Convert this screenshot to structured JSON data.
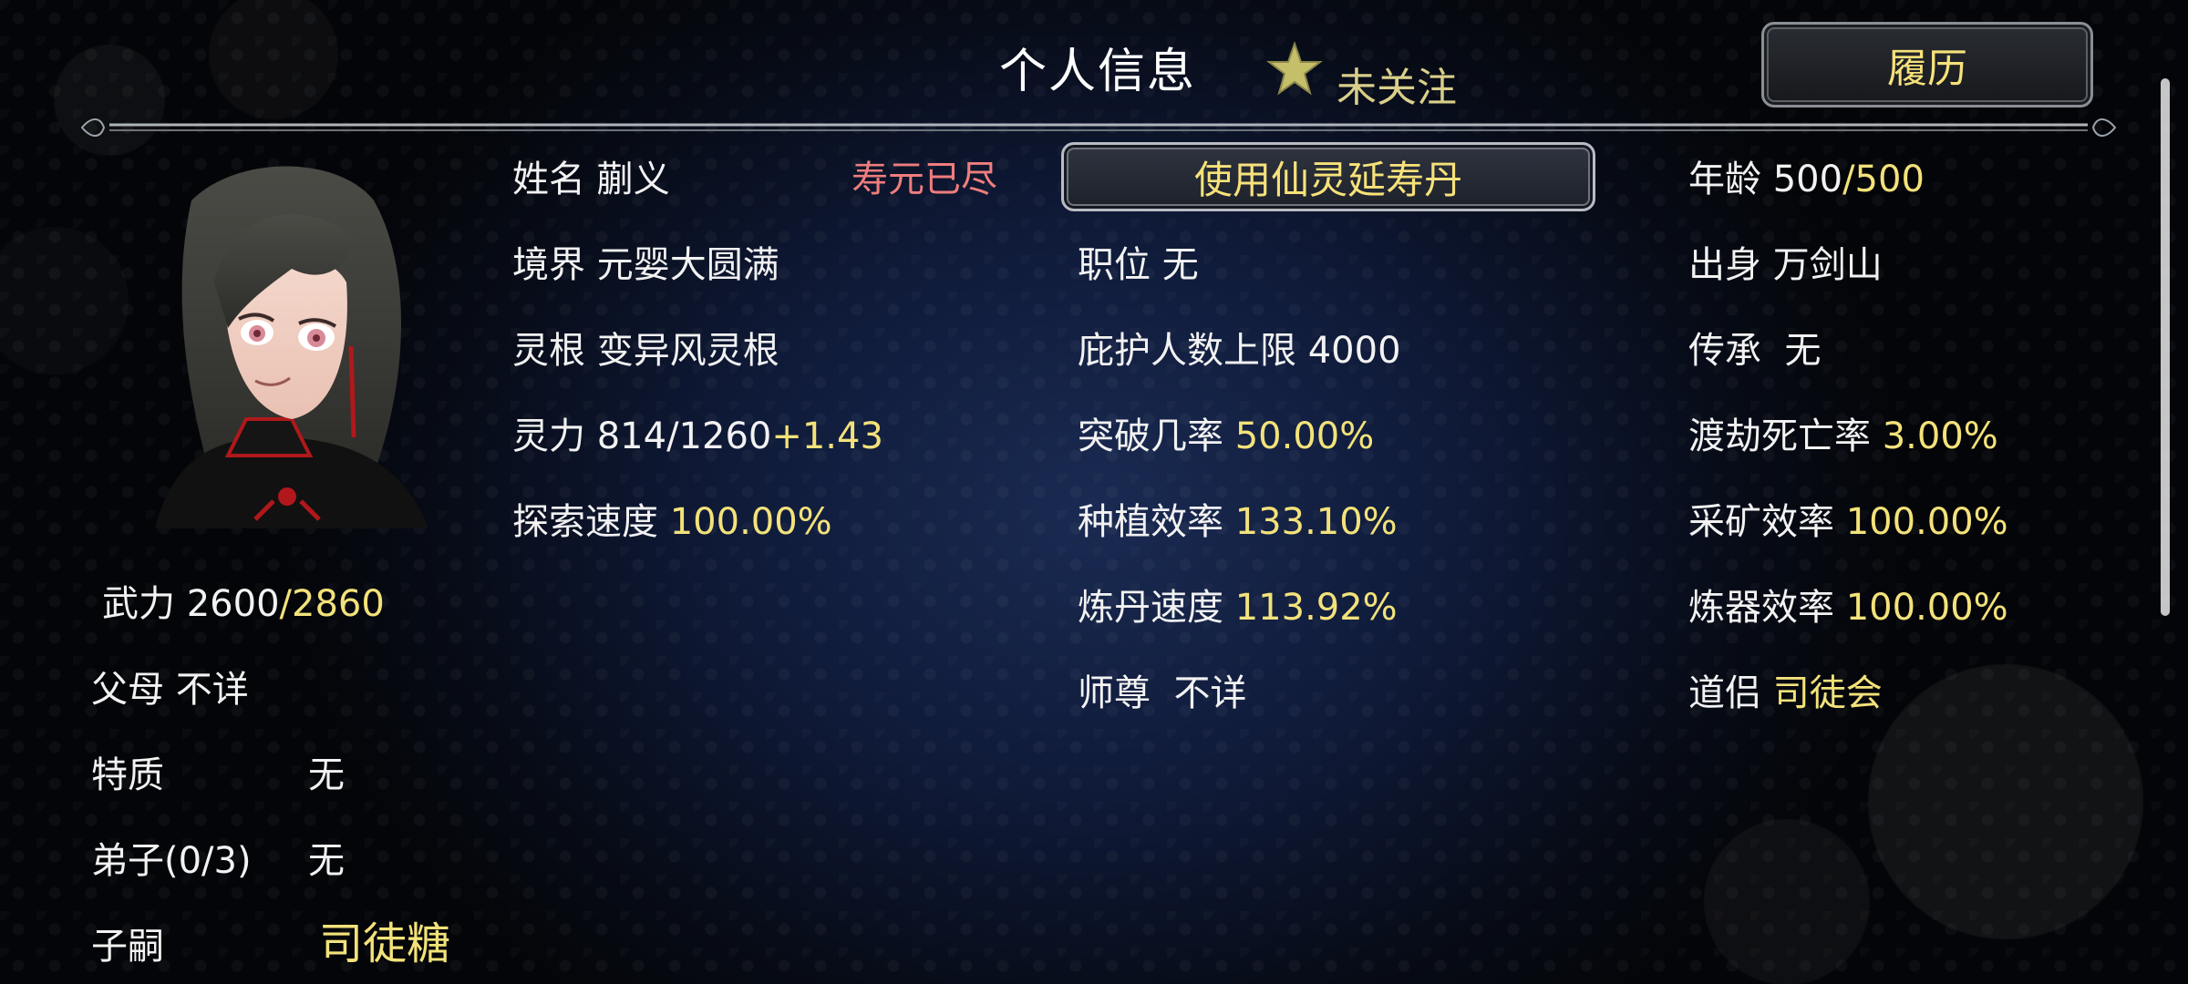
{
  "header": {
    "title": "个人信息",
    "follow_label": "未关注",
    "history_button": "履历"
  },
  "left": {
    "force_label": "武力",
    "force_value": "2600",
    "force_max": "/2860",
    "parents_label": "父母",
    "parents_value": "不详",
    "traits_label": "特质",
    "traits_value": "无",
    "disciples_label": "弟子(0/3)",
    "disciples_value": "无",
    "heirs_label": "子嗣",
    "heirs_value": "司徒糖"
  },
  "col1": {
    "name_label": "姓名",
    "name_value": "蒯义",
    "status": "寿元已尽",
    "realm_label": "境界",
    "realm_value": "元婴大圆满",
    "root_label": "灵根",
    "root_value": "变异风灵根",
    "power_label": "灵力",
    "power_value": "814/1260",
    "power_rate": "+1.43",
    "explore_label": "探索速度",
    "explore_value": "100.00%"
  },
  "col2": {
    "use_button": "使用仙灵延寿丹",
    "position_label": "职位",
    "position_value": "无",
    "protect_label": "庇护人数上限",
    "protect_value": "4000",
    "breakthrough_label": "突破几率",
    "breakthrough_value": "50.00%",
    "plant_label": "种植效率",
    "plant_value": "133.10%",
    "alchemy_label": "炼丹速度",
    "alchemy_value": "113.92%",
    "master_label": "师尊",
    "master_value": "不详"
  },
  "col3": {
    "age_label": "年龄",
    "age_value": "500",
    "age_max": "/500",
    "origin_label": "出身",
    "origin_value": "万剑山",
    "inherit_label": "传承",
    "inherit_value": "无",
    "tribulation_label": "渡劫死亡率",
    "tribulation_value": "3.00%",
    "mining_label": "采矿效率",
    "mining_value": "100.00%",
    "forging_label": "炼器效率",
    "forging_value": "100.00%",
    "partner_label": "道侣",
    "partner_value": "司徒会"
  },
  "icons": {
    "follow": "star-icon",
    "avatar": "character-portrait"
  },
  "colors": {
    "gold": "#f3e27a",
    "red": "#ef7d7d"
  }
}
